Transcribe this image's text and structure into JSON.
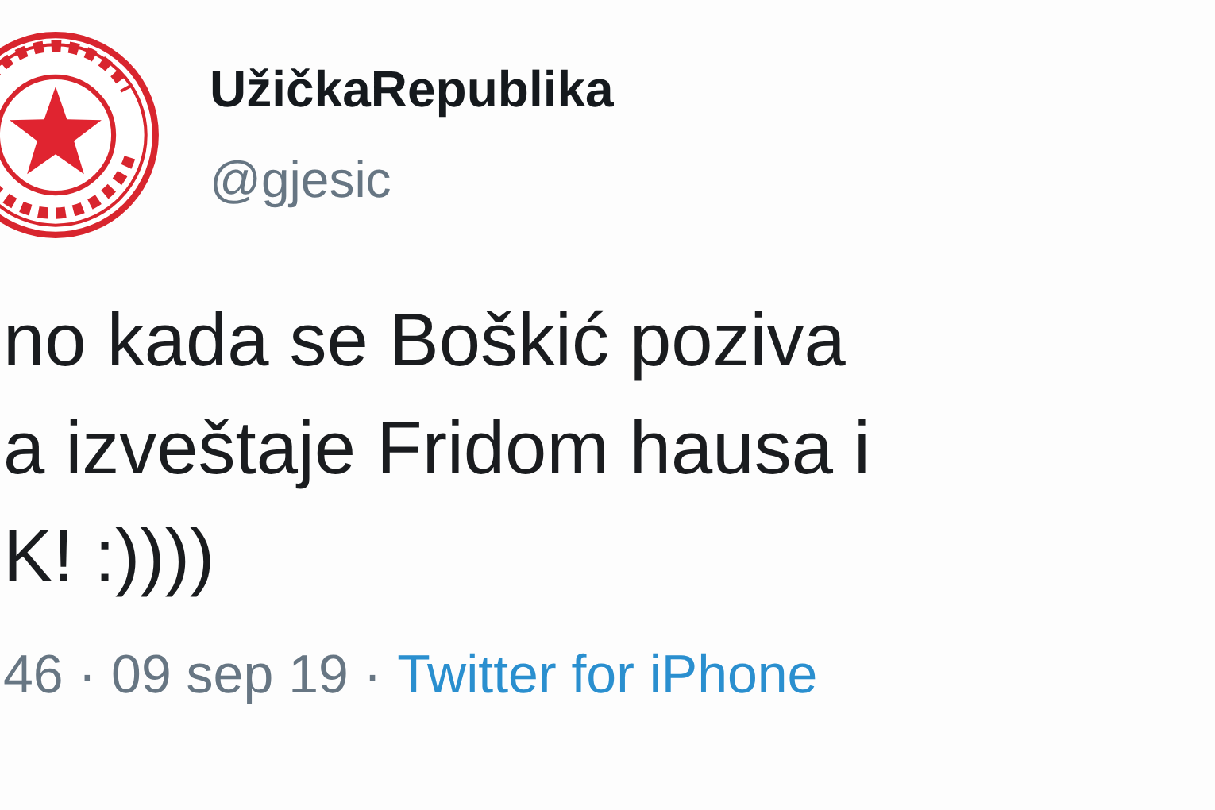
{
  "author": {
    "name": "UžičkaRepublika",
    "handle": "@gjesic"
  },
  "tweet": {
    "lines": [
      "no kada se Boškić poziva",
      "a izveštaje Fridom hausa i",
      "K! :))))"
    ]
  },
  "meta": {
    "timestamp": "46 · 09 sep 19 ·",
    "source": "Twitter for iPhone"
  }
}
